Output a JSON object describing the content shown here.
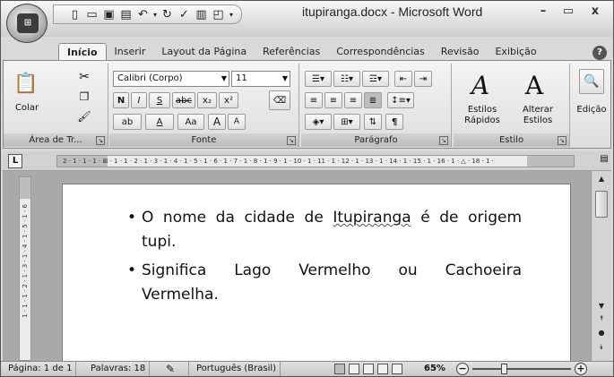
{
  "app": {
    "window_title": "itupiranga.docx - Microsoft Word",
    "office_button_label": "Office",
    "controls": {
      "minimize": "–",
      "maximize": "▭",
      "close": "x"
    },
    "quick_access": [
      "save-icon",
      "undo-icon",
      "redo-icon"
    ]
  },
  "tabs": [
    {
      "label": "Início",
      "active": true
    },
    {
      "label": "Inserir"
    },
    {
      "label": "Layout da Página"
    },
    {
      "label": "Referências"
    },
    {
      "label": "Correspondências"
    },
    {
      "label": "Revisão"
    },
    {
      "label": "Exibição"
    }
  ],
  "ribbon": {
    "clipboard": {
      "label": "Área de Tr...",
      "paste": "Colar"
    },
    "font": {
      "label": "Fonte",
      "font_name": "Calibri (Corpo)",
      "font_size": "11",
      "bold": "N",
      "italic": "I",
      "underline": "S",
      "strike": "abc",
      "subscript": "x₂",
      "superscript": "x²",
      "change_case": "Aa",
      "grow": "A",
      "shrink": "A"
    },
    "paragraph": {
      "label": "Parágrafo",
      "pilcrow": "¶"
    },
    "styles": {
      "label": "Estilo",
      "quick_styles": "Estilos Rápidos",
      "change_styles": "Alterar Estilos"
    },
    "editing": {
      "label": "Edição"
    }
  },
  "ruler": {
    "corner": "L",
    "h_text": "2 · 1 · 1 · 1 · ⊠ · 1 · 1 · 2 · 1 · 3 · 1 · 4 · 1 · 5 · 1 · 6 · 1 · 7 · 1 · 8 · 1 · 9 · 1 · 10 · 1 · 11 · 1 · 12 · 1 · 13 · 1 · 14 · 1 · 15 · 1 · 16 · 1 · △ · 18 · 1 ·",
    "v_text": "1 · 1 · 1 · 2 · 1 · 3 · 1 · 4 · 1 · 5 · 1 · 6"
  },
  "document": {
    "bullets": [
      {
        "before": "O nome da cidade de ",
        "misspelled": "Itupiranga",
        "after": " é de origem tupi."
      },
      {
        "before": "Significa Lago Vermelho ou Cachoeira Vermelha.",
        "misspelled": "",
        "after": ""
      }
    ]
  },
  "status": {
    "page": "Página: 1 de 1",
    "words": "Palavras: 18",
    "language": "Português (Brasil)",
    "zoom": "65%",
    "zoom_level_percent": 65
  }
}
